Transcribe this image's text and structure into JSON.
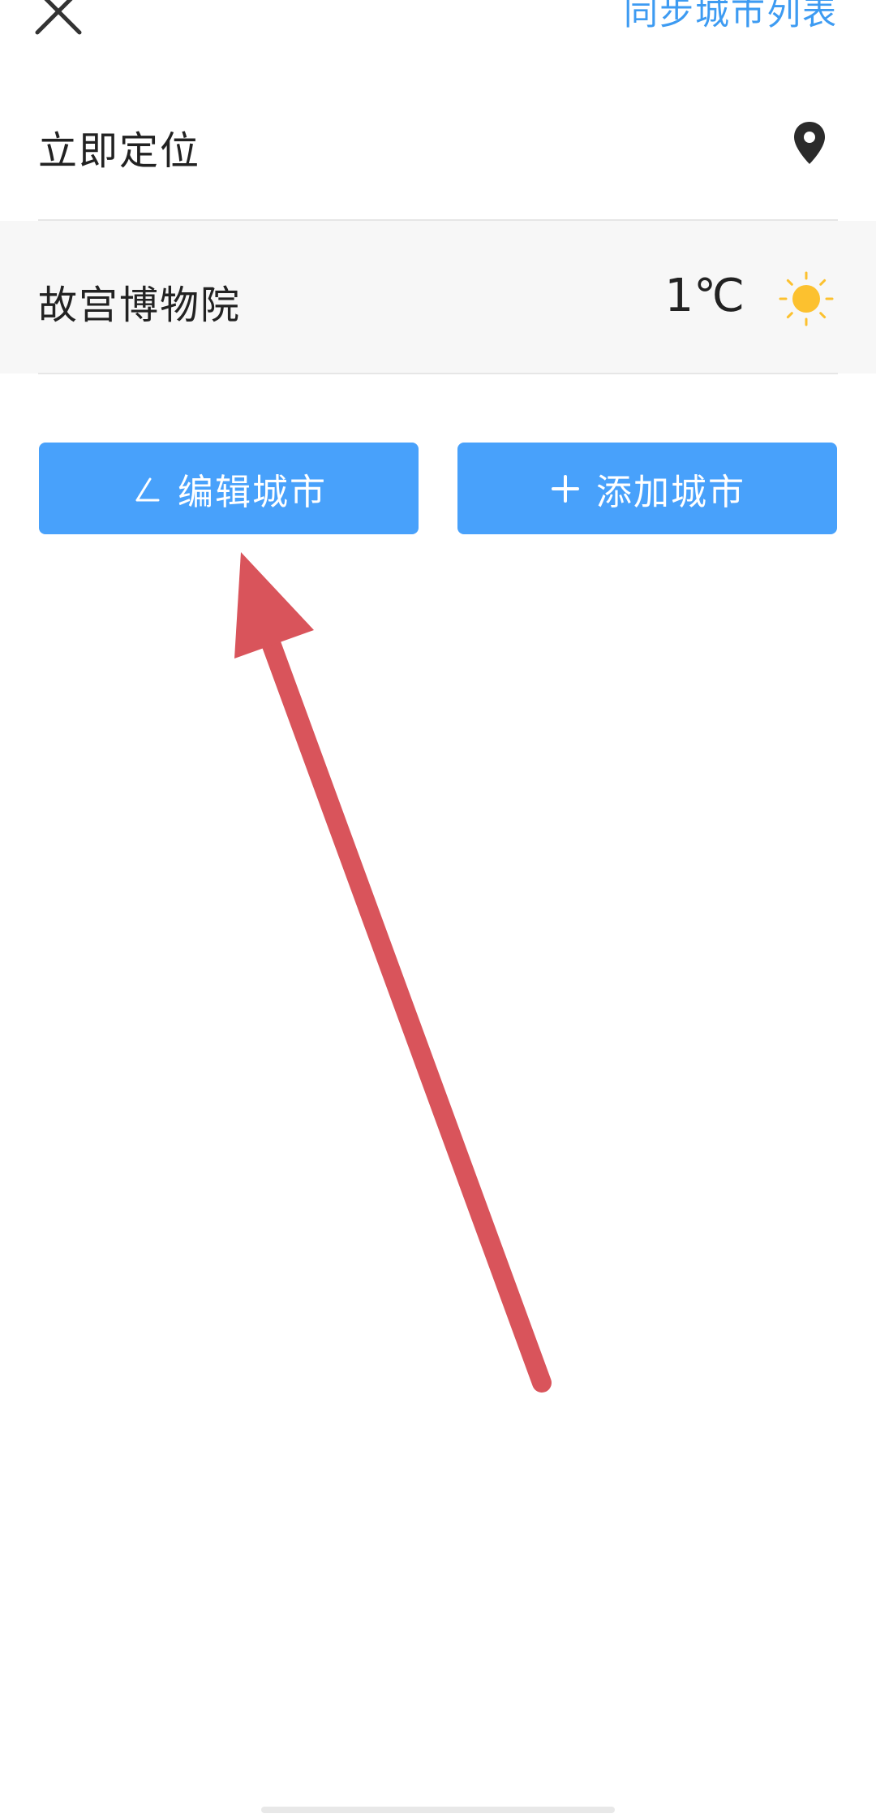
{
  "top_bar": {
    "close_icon": "close-icon",
    "sync_label": "同步城市列表"
  },
  "locate_row": {
    "label": "立即定位",
    "icon": "location-pin-icon"
  },
  "city_row": {
    "name": "故宫博物院",
    "temperature": "1℃",
    "weather_icon": "sun-icon"
  },
  "buttons": {
    "edit_label": "编辑城市",
    "edit_icon": "pencil-icon",
    "add_label": "添加城市",
    "add_icon": "plus-icon"
  },
  "colors": {
    "accent": "#48a1fb",
    "link": "#3d9bf2",
    "arrow": "#d9545b",
    "sun": "#fcc12f"
  }
}
